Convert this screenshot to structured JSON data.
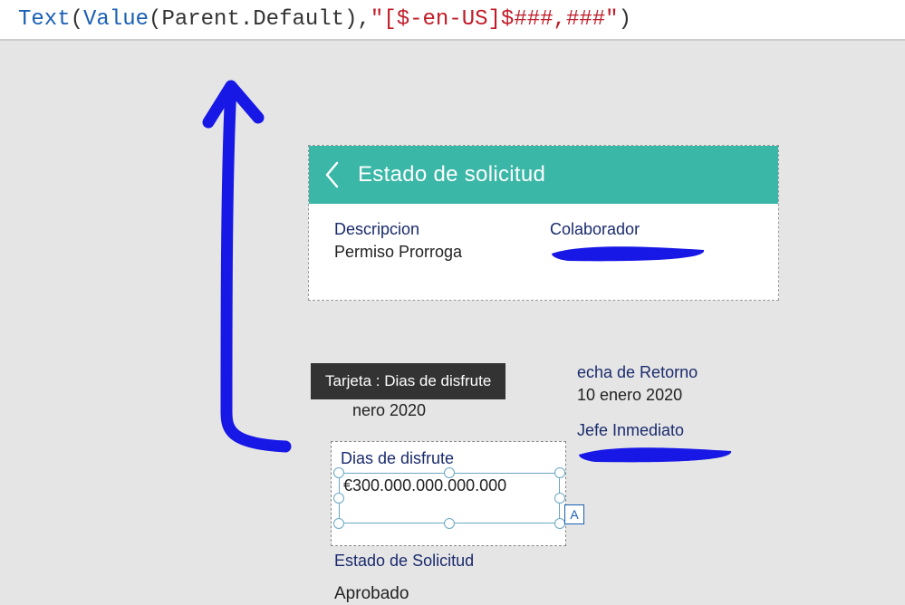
{
  "formula": {
    "func1": "Text",
    "func2": "Value",
    "obj": "Parent",
    "prop": "Default",
    "str": "\"[$-en-US]$###,###\""
  },
  "tooltip": "Tarjeta : Dias de disfrute",
  "header": {
    "title": "Estado de solicitud"
  },
  "labels": {
    "descripcion": "Descripcion",
    "colaborador": "Colaborador",
    "fecha_retorno": "echa de Retorno",
    "dias_disfrute": "Dias de disfrute",
    "jefe": "Jefe Inmediato",
    "estado": "Estado de Solicitud"
  },
  "values": {
    "descripcion": "Permiso Prorroga",
    "fecha_cut": "nero 2020",
    "fecha_retorno": "10 enero 2020",
    "dias_disfrute": "€300.000.000.000.000",
    "estado": "Aprobado",
    "badge": "A"
  }
}
